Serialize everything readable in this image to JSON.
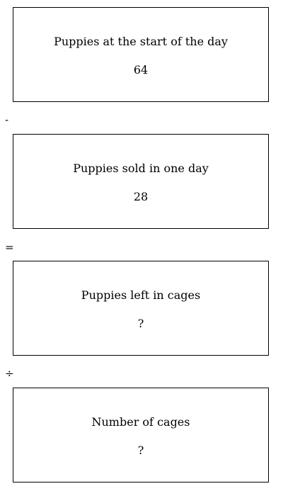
{
  "boxes": [
    {
      "label": "Puppies at the start of the day",
      "value": "64"
    },
    {
      "label": "Puppies sold in one day",
      "value": "28"
    },
    {
      "label": "Puppies left in cages",
      "value": "?"
    },
    {
      "label": "Number of cages",
      "value": "?"
    }
  ],
  "operators": [
    "-",
    "=",
    "÷"
  ]
}
